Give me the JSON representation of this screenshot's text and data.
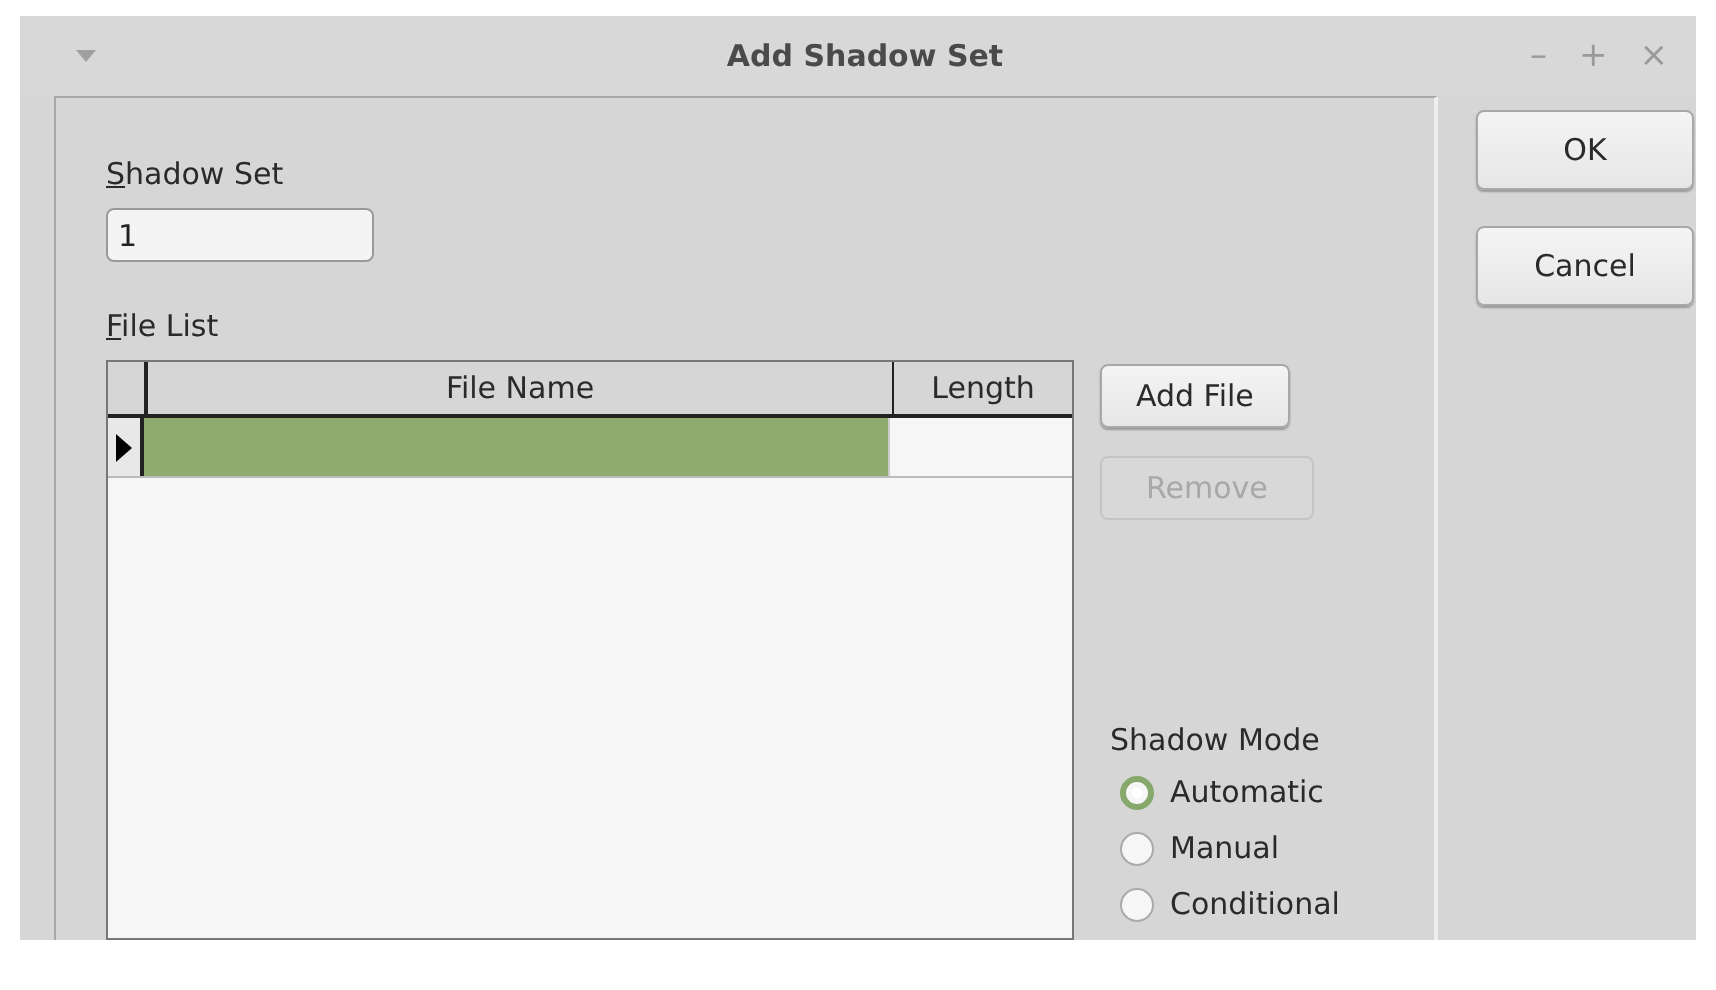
{
  "window": {
    "title": "Add Shadow Set",
    "controls": [
      "–",
      "+",
      "×"
    ]
  },
  "shadow_set": {
    "label": "Shadow Set",
    "mnemonic": true,
    "value": "1"
  },
  "file_list": {
    "label": "File List",
    "mnemonic": true,
    "columns": [
      "File Name",
      "Length"
    ],
    "rows": [
      {
        "selected": true,
        "current": true
      }
    ]
  },
  "side_buttons": [
    {
      "label": "Add File",
      "disabled": false
    },
    {
      "label": "Remove",
      "disabled": true
    }
  ],
  "shadow_mode": {
    "label": "Shadow Mode",
    "options": [
      {
        "label": "Automatic",
        "selected": true
      },
      {
        "label": "Manual",
        "selected": false
      },
      {
        "label": "Conditional",
        "selected": false
      }
    ]
  },
  "buttons": [
    {
      "label": "OK"
    },
    {
      "label": "Cancel"
    }
  ]
}
